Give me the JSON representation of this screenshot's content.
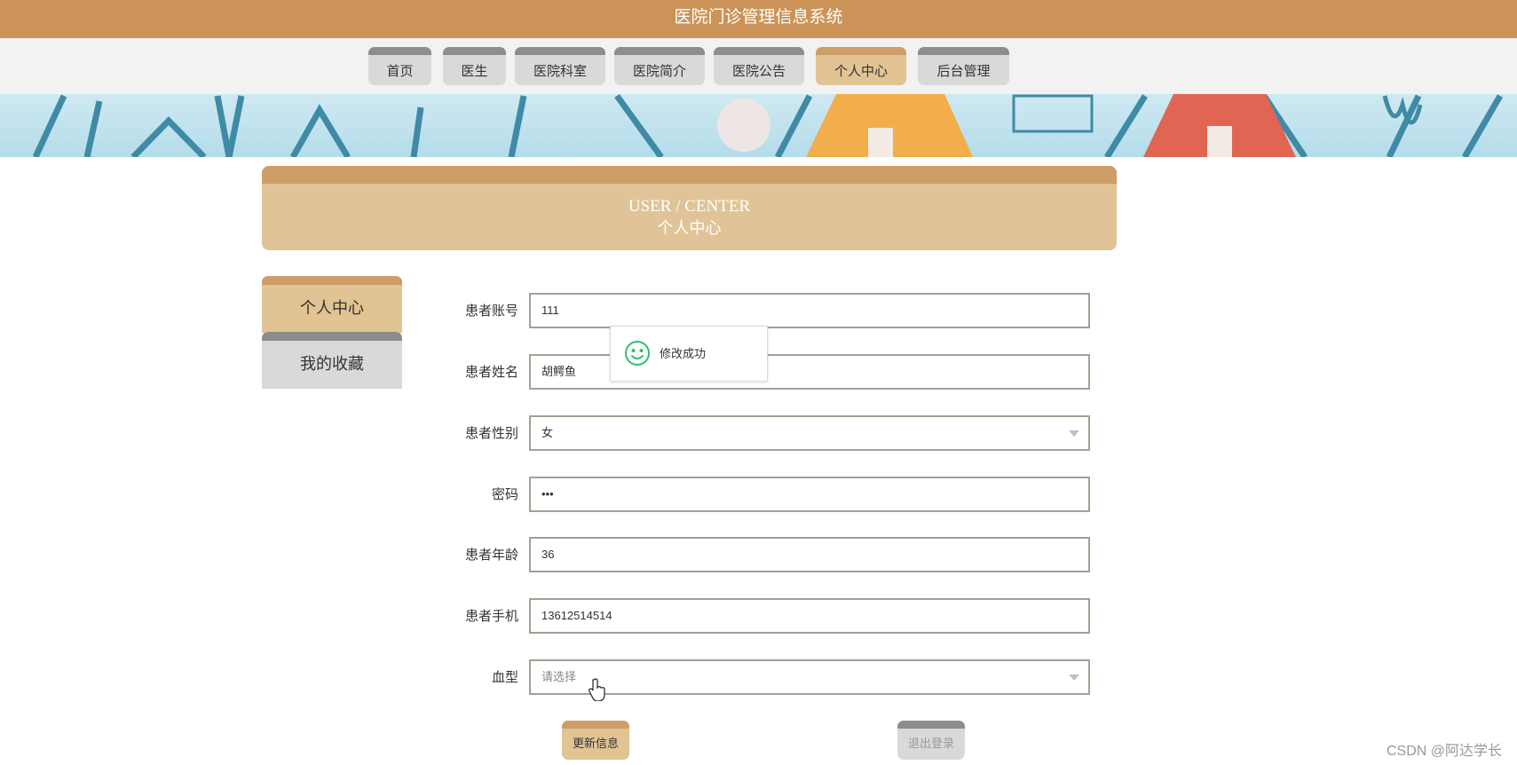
{
  "header": {
    "title": "医院门诊管理信息系统"
  },
  "nav": {
    "items": [
      {
        "label": "首页",
        "active": false
      },
      {
        "label": "医生",
        "active": false
      },
      {
        "label": "医院科室",
        "active": false
      },
      {
        "label": "医院简介",
        "active": false
      },
      {
        "label": "医院公告",
        "active": false
      },
      {
        "label": "个人中心",
        "active": true
      },
      {
        "label": "后台管理",
        "active": false
      }
    ]
  },
  "page_header": {
    "en": "USER / CENTER",
    "cn": "个人中心"
  },
  "sidebar": {
    "items": [
      {
        "label": "个人中心",
        "active": true
      },
      {
        "label": "我的收藏",
        "active": false
      }
    ]
  },
  "form": {
    "account": {
      "label": "患者账号",
      "value": "111"
    },
    "name": {
      "label": "患者姓名",
      "value": "胡鳄鱼"
    },
    "gender": {
      "label": "患者性别",
      "value": "女"
    },
    "password": {
      "label": "密码",
      "value": "•••"
    },
    "age": {
      "label": "患者年龄",
      "value": "36"
    },
    "phone": {
      "label": "患者手机",
      "value": "13612514514"
    },
    "blood_type": {
      "label": "血型",
      "placeholder": "请选择"
    }
  },
  "toast": {
    "message": "修改成功",
    "icon": "smiley-icon"
  },
  "buttons": {
    "update": "更新信息",
    "logout": "退出登录"
  },
  "watermark": "CSDN @阿达学长",
  "colors": {
    "header": "#cb9358",
    "accent_top": "#cf9d67",
    "accent": "#e1c394",
    "inactive": "#d9d9d9",
    "inactive_top": "#8d8d8d",
    "toast_icon": "#2fbf71"
  }
}
